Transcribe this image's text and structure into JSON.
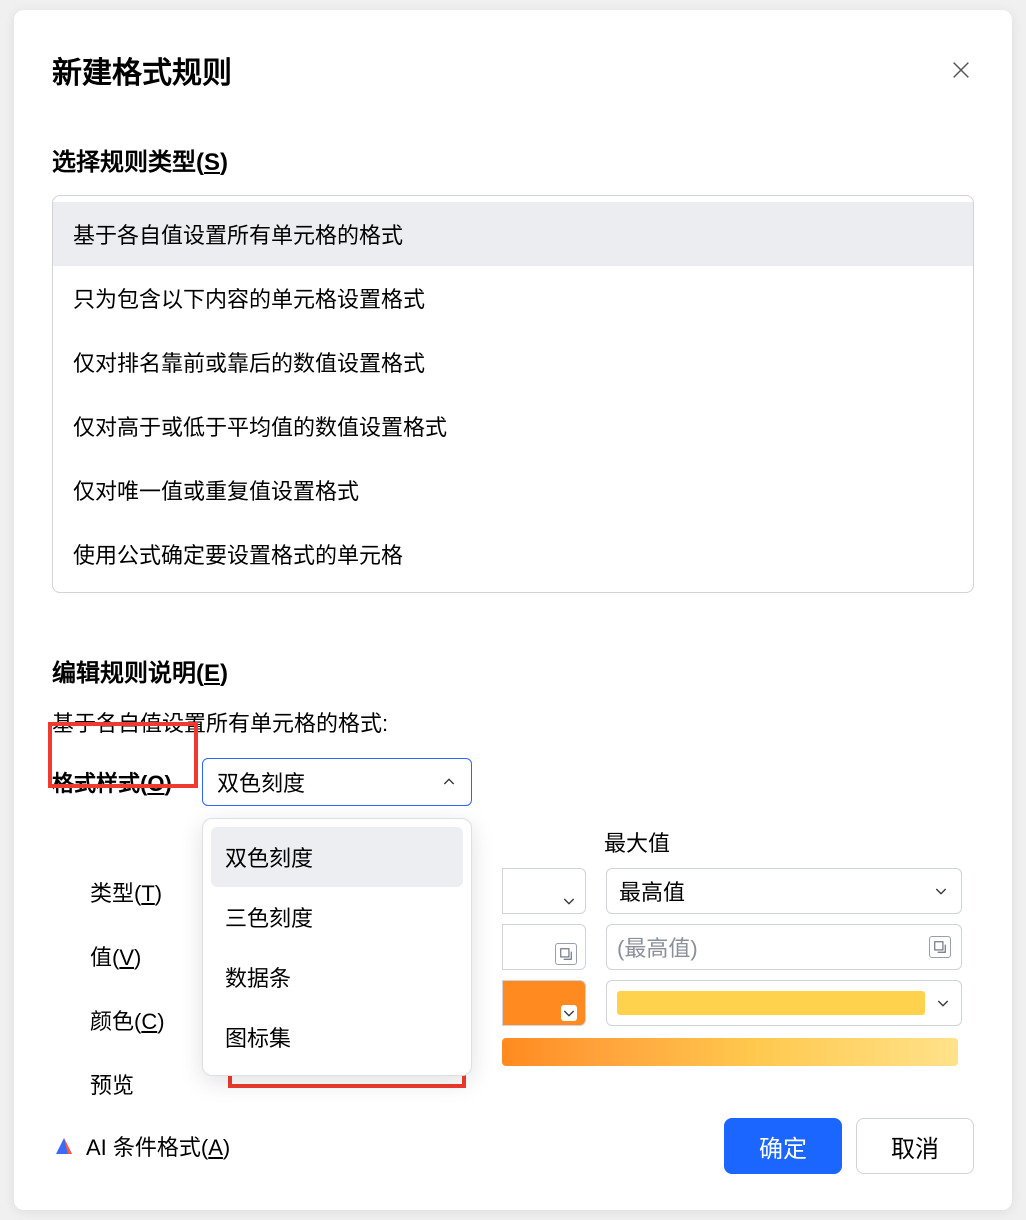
{
  "dialog": {
    "title": "新建格式规则"
  },
  "ruleType": {
    "section_label_prefix": "选择规则类型(",
    "section_label_key": "S",
    "section_label_suffix": ")",
    "items": [
      "基于各自值设置所有单元格的格式",
      "只为包含以下内容的单元格设置格式",
      "仅对排名靠前或靠后的数值设置格式",
      "仅对高于或低于平均值的数值设置格式",
      "仅对唯一值或重复值设置格式",
      "使用公式确定要设置格式的单元格"
    ]
  },
  "editRule": {
    "section_label_prefix": "编辑规则说明(",
    "section_label_key": "E",
    "section_label_suffix": ")",
    "description": "基于各自值设置所有单元格的格式:",
    "style_label_prefix": "格式样式(",
    "style_label_key": "O",
    "style_label_suffix": ")",
    "style_value": "双色刻度",
    "style_options": [
      "双色刻度",
      "三色刻度",
      "数据条",
      "图标集"
    ],
    "rows": {
      "type_prefix": "类型(",
      "type_key": "T",
      "type_suffix": ")",
      "value_prefix": "值(",
      "value_key": "V",
      "value_suffix": ")",
      "color_prefix": "颜色(",
      "color_key": "C",
      "color_suffix": ")",
      "preview": "预览"
    },
    "columns": {
      "max": "最大值",
      "max_type_value": "最高值",
      "max_value_placeholder": "(最高值)"
    }
  },
  "footer": {
    "ai_prefix": "AI 条件格式(",
    "ai_key": "A",
    "ai_suffix": ")",
    "ok": "确定",
    "cancel": "取消"
  },
  "colors": {
    "accent": "#1a66ff",
    "highlight_red": "#ef3b2f",
    "swatch_orange": "#ff8a1f",
    "swatch_yellow": "#ffd24d"
  }
}
